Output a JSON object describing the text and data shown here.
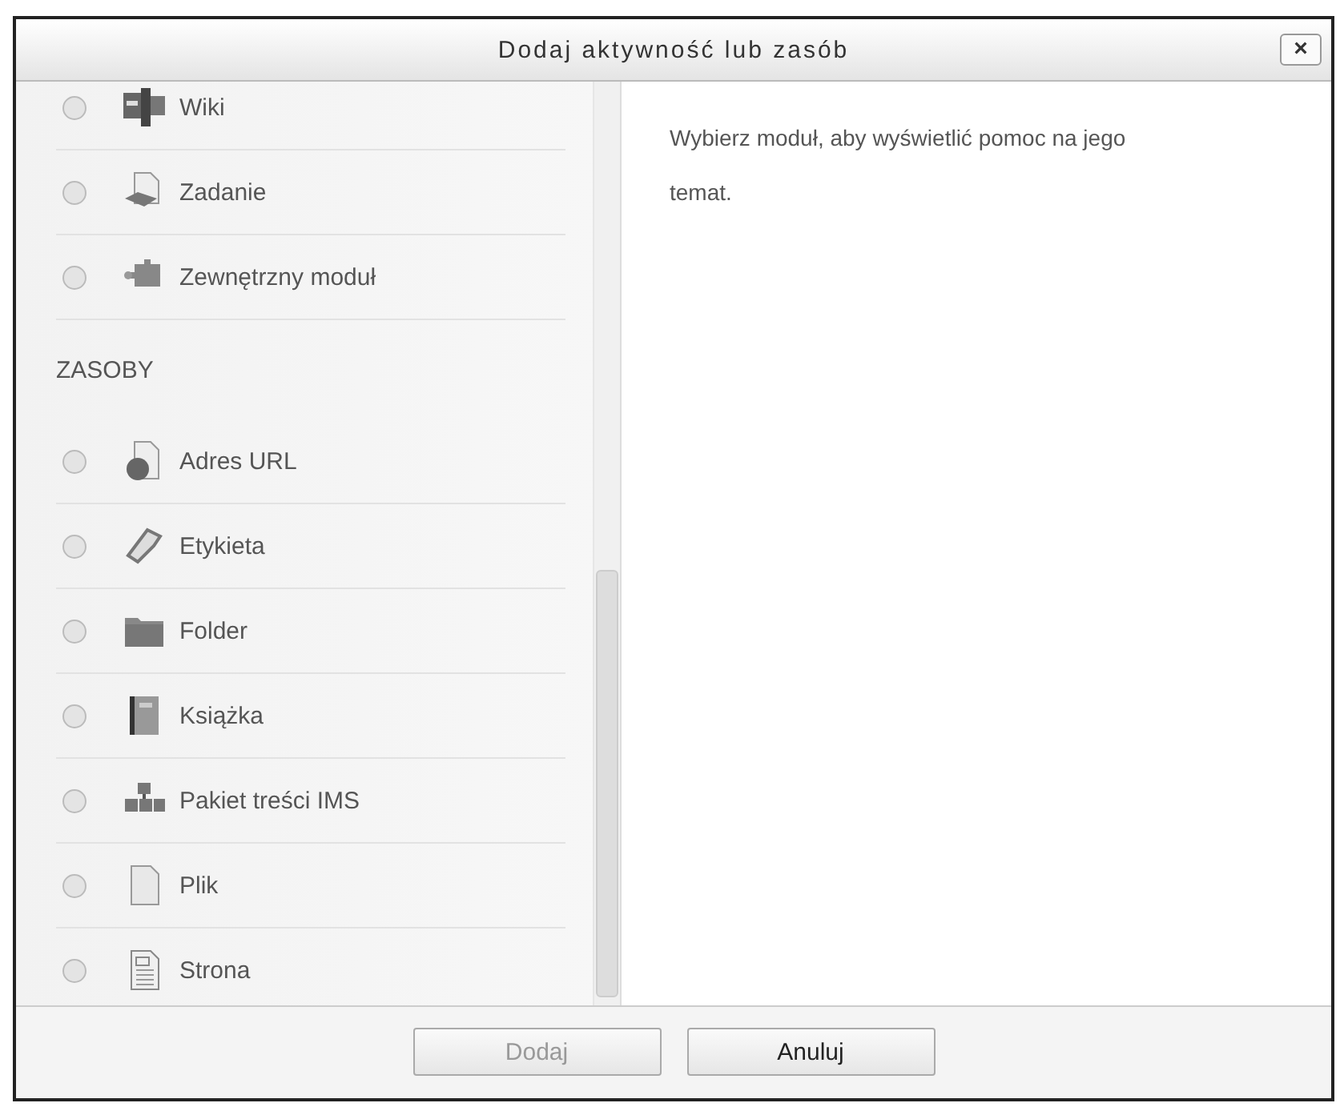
{
  "dialog": {
    "title": "Dodaj aktywność lub zasób",
    "close": "×"
  },
  "list": [
    {
      "kind": "module",
      "label": "Wiki",
      "selected": false
    },
    {
      "kind": "module",
      "label": "Zadanie",
      "selected": false
    },
    {
      "kind": "module",
      "label": "Zewnętrzny moduł",
      "selected": false
    },
    {
      "kind": "heading",
      "label": "ZASOBY"
    },
    {
      "kind": "module",
      "label": "Adres URL",
      "selected": false
    },
    {
      "kind": "module",
      "label": "Etykieta",
      "selected": false
    },
    {
      "kind": "module",
      "label": "Folder",
      "selected": false
    },
    {
      "kind": "module",
      "label": "Książka",
      "selected": false
    },
    {
      "kind": "module",
      "label": "Pakiet treści IMS",
      "selected": false
    },
    {
      "kind": "module",
      "label": "Plik",
      "selected": false
    },
    {
      "kind": "module",
      "label": "Strona",
      "selected": false
    }
  ],
  "help": "Wybierz moduł, aby wyświetlić pomoc na jego temat.",
  "buttons": [
    {
      "label": "Dodaj",
      "disabled": true
    },
    {
      "label": "Anuluj",
      "disabled": false
    }
  ]
}
